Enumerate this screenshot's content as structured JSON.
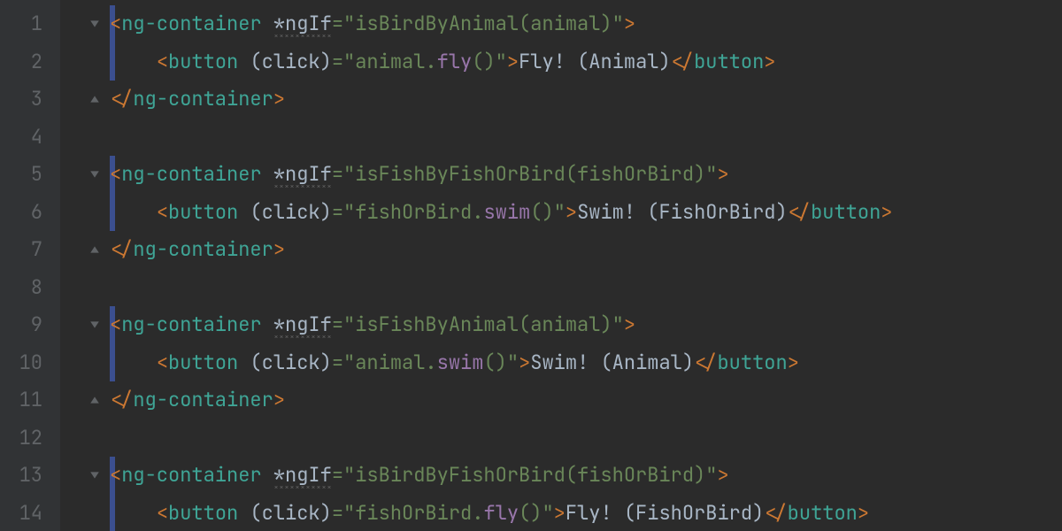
{
  "editor": {
    "first_line_number": 1,
    "lines": [
      {
        "fold": "open",
        "change": true,
        "open_tag": "ng-container",
        "directive_attr": "*ngIf",
        "directive_value": "\"isBirdByAnimal(animal)\"",
        "kind": "container-open"
      },
      {
        "change": true,
        "indent": "    ",
        "open_tag": "button",
        "event_attr": "(click)",
        "event_value": "\"animal.fly()\"",
        "text_content": "Fly! (Animal)",
        "close_tag": "button",
        "kind": "button"
      },
      {
        "fold": "close",
        "close_tag": "ng-container",
        "kind": "container-close"
      },
      {
        "kind": "blank"
      },
      {
        "fold": "open",
        "change": true,
        "open_tag": "ng-container",
        "directive_attr": "*ngIf",
        "directive_value": "\"isFishByFishOrBird(fishOrBird)\"",
        "kind": "container-open"
      },
      {
        "change": true,
        "indent": "    ",
        "open_tag": "button",
        "event_attr": "(click)",
        "event_value": "\"fishOrBird.swim()\"",
        "text_content": "Swim! (FishOrBird)",
        "close_tag": "button",
        "kind": "button"
      },
      {
        "fold": "close",
        "close_tag": "ng-container",
        "kind": "container-close"
      },
      {
        "kind": "blank"
      },
      {
        "fold": "open",
        "change": true,
        "open_tag": "ng-container",
        "directive_attr": "*ngIf",
        "directive_value": "\"isFishByAnimal(animal)\"",
        "kind": "container-open"
      },
      {
        "change": true,
        "indent": "    ",
        "open_tag": "button",
        "event_attr": "(click)",
        "event_value": "\"animal.swim()\"",
        "text_content": "Swim! (Animal)",
        "close_tag": "button",
        "kind": "button"
      },
      {
        "fold": "close",
        "close_tag": "ng-container",
        "kind": "container-close"
      },
      {
        "kind": "blank"
      },
      {
        "fold": "open",
        "change": true,
        "open_tag": "ng-container",
        "directive_attr": "*ngIf",
        "directive_value": "\"isBirdByFishOrBird(fishOrBird)\"",
        "kind": "container-open"
      },
      {
        "change": true,
        "indent": "    ",
        "open_tag": "button",
        "event_attr": "(click)",
        "event_value": "\"fishOrBird.fly()\"",
        "text_content": "Fly! (FishOrBird)",
        "close_tag": "button",
        "kind": "button"
      }
    ]
  },
  "colors": {
    "background": "#2b2b2b",
    "gutter_bg": "#313335",
    "gutter_fg": "#606366",
    "punct": "#cc7832",
    "tag": "#3fa596",
    "attr": "#a9b7c6",
    "string": "#6a8759",
    "call": "#9876aa",
    "change_bar": "#3b4f8f"
  }
}
